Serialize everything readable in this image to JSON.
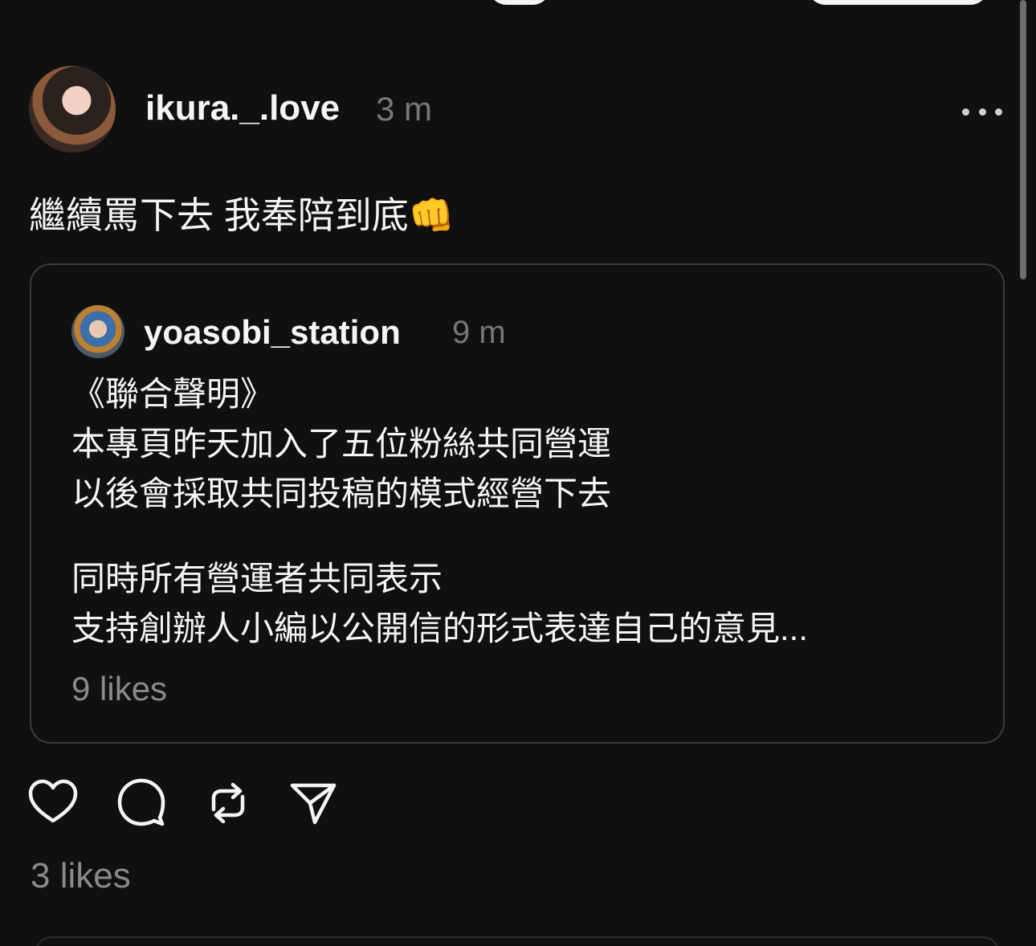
{
  "post": {
    "username": "ikura._.love",
    "timestamp": "3 m",
    "text": "繼續罵下去 我奉陪到底👊",
    "likes": "3 likes"
  },
  "quote": {
    "username": "yoasobi_station",
    "timestamp": "9 m",
    "lines": [
      "《聯合聲明》",
      "本專頁昨天加入了五位粉絲共同營運",
      "以後會採取共同投稿的模式經營下去",
      "同時所有營運者共同表示",
      "支持創辦人小編以公開信的形式表達自己的意見..."
    ],
    "likes": "9 likes"
  },
  "actions": {
    "like_icon": "heart-icon",
    "reply_icon": "comment-icon",
    "repost_icon": "repost-icon",
    "share_icon": "send-icon"
  },
  "colors": {
    "background": "#101010",
    "text": "#f3f5f7",
    "muted": "#777777",
    "border": "#3a3a3a"
  }
}
